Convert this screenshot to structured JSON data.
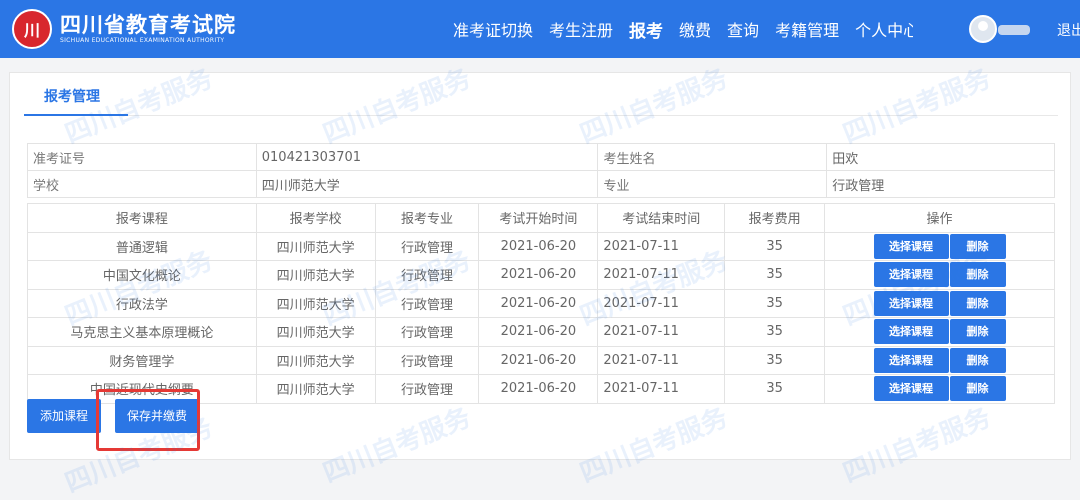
{
  "header": {
    "logo_mark": "川",
    "logo_cn": "四川省教育考试院",
    "logo_en": "SICHUAN EDUCATIONAL EXAMINATION AUTHORITY",
    "nav": [
      {
        "label": "准考证切换"
      },
      {
        "label": "考生注册"
      },
      {
        "label": "报考"
      },
      {
        "label": "缴费"
      },
      {
        "label": "查询"
      },
      {
        "label": "考籍管理"
      },
      {
        "label": "个人中心"
      }
    ],
    "active_nav": "报考",
    "logout": "退出"
  },
  "tab": {
    "label": "报考管理"
  },
  "info": {
    "ticket_label": "准考证号",
    "ticket_value": "010421303701",
    "name_label": "考生姓名",
    "name_value": "田欢",
    "school_label": "学校",
    "school_value": "四川师范大学",
    "major_label": "专业",
    "major_value": "行政管理"
  },
  "courses": {
    "headers": [
      "报考课程",
      "报考学校",
      "报考专业",
      "考试开始时间",
      "考试结束时间",
      "报考费用",
      "操作"
    ],
    "rows": [
      {
        "course": "普通逻辑",
        "school": "四川师范大学",
        "major": "行政管理",
        "start": "2021-06-20",
        "end": "2021-07-11",
        "fee": "35"
      },
      {
        "course": "中国文化概论",
        "school": "四川师范大学",
        "major": "行政管理",
        "start": "2021-06-20",
        "end": "2021-07-11",
        "fee": "35"
      },
      {
        "course": "行政法学",
        "school": "四川师范大学",
        "major": "行政管理",
        "start": "2021-06-20",
        "end": "2021-07-11",
        "fee": "35"
      },
      {
        "course": "马克思主义基本原理概论",
        "school": "四川师范大学",
        "major": "行政管理",
        "start": "2021-06-20",
        "end": "2021-07-11",
        "fee": "35"
      },
      {
        "course": "财务管理学",
        "school": "四川师范大学",
        "major": "行政管理",
        "start": "2021-06-20",
        "end": "2021-07-11",
        "fee": "35"
      },
      {
        "course": "中国近现代史纲要",
        "school": "四川师范大学",
        "major": "行政管理",
        "start": "2021-06-20",
        "end": "2021-07-11",
        "fee": "35"
      }
    ],
    "select_btn": "选择课程",
    "delete_btn": "删除"
  },
  "actions": {
    "add": "添加课程",
    "save_pay": "保存并缴费"
  },
  "watermark": "四川自考服务",
  "colors": {
    "primary": "#2b76e5",
    "highlight": "#e53935",
    "logo_red": "#d8272d"
  }
}
